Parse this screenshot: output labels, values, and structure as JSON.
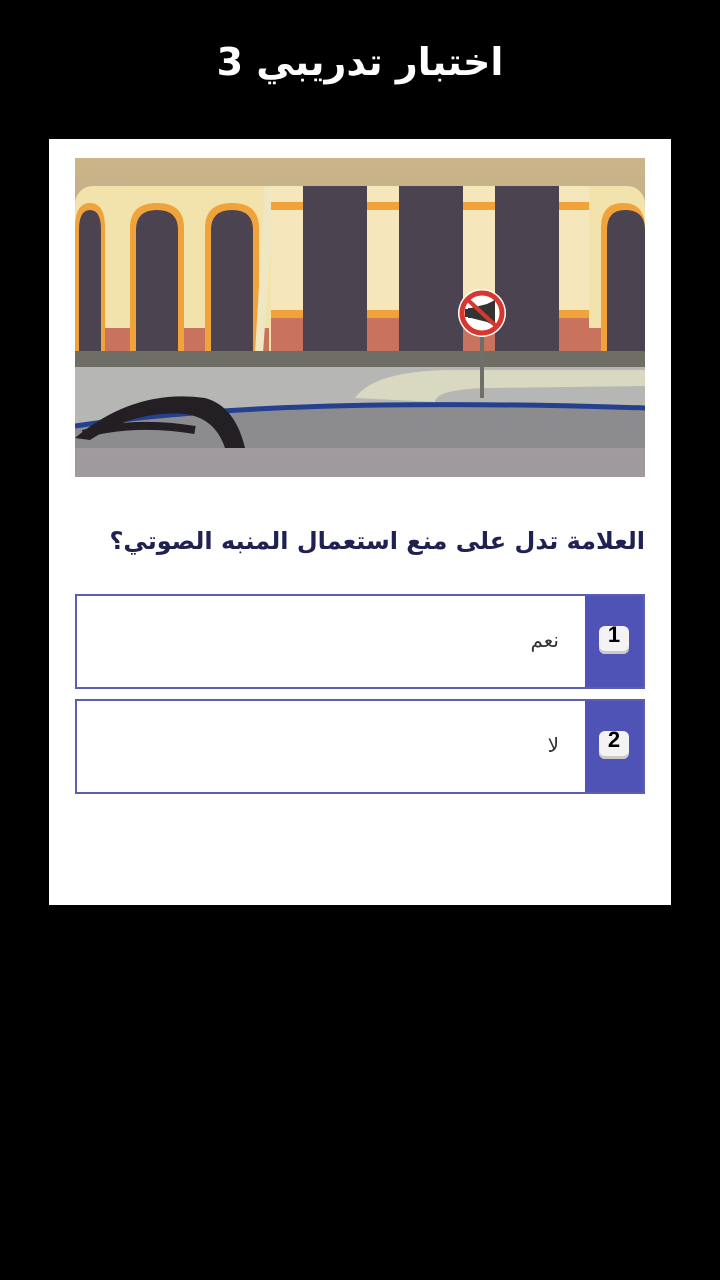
{
  "header": {
    "title": "اختبار تدريبي 3"
  },
  "question": {
    "text": "العلامة تدل على منع استعمال المنبه الصوتي؟"
  },
  "options": [
    {
      "number": "1",
      "label": "نعم"
    },
    {
      "number": "2",
      "label": "لا"
    }
  ],
  "colors": {
    "accent": "#4f53b6",
    "question_text": "#1e2152",
    "background": "#000000",
    "card": "#ffffff"
  },
  "image": {
    "depicts": "no-horn-sign-street-scene"
  }
}
